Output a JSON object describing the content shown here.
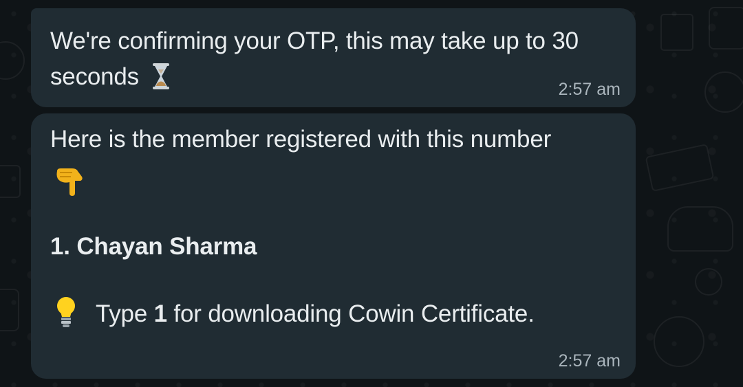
{
  "messages": [
    {
      "text": "We're confirming your OTP, this may take up to 30 seconds",
      "icon": "hourglass-icon",
      "time": "2:57 am"
    },
    {
      "intro": "Here is the member registered with this number",
      "pointer_icon": "backhand-index-pointing-down-icon",
      "member": "1. Chayan Sharma",
      "tip_icon": "light-bulb-icon",
      "tip_prefix": "Type",
      "tip_number": "1",
      "tip_suffix": "for downloading Cowin Certificate.",
      "time": "2:57 am"
    }
  ],
  "colors": {
    "background": "#0f1417",
    "bubble": "#202c33",
    "text": "#e9edef",
    "timestamp": "#aab5bc"
  }
}
